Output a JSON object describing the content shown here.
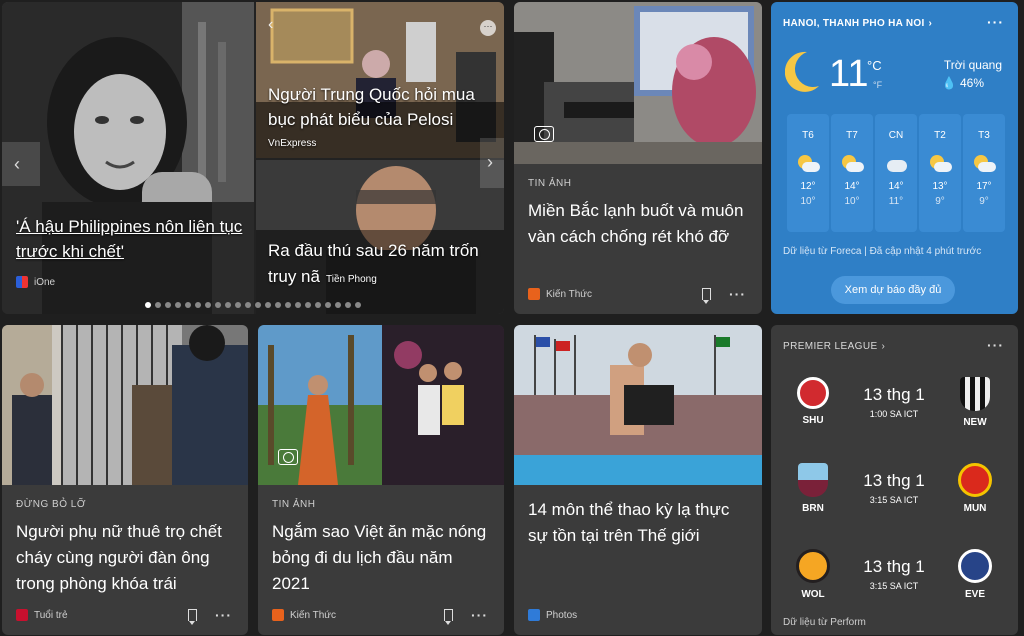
{
  "hero": {
    "left_title": "'Á hậu Philippines nôn liên tục trước khi chết'",
    "left_source": "iOne",
    "top_title": "Người Trung Quốc hỏi mua bục phát biểu của Pelosi",
    "top_source": "VnExpress",
    "bottom_title": "Ra đầu thú sau 26 năm trốn truy nã",
    "bottom_source": "Tiền Phong"
  },
  "card_cold": {
    "kicker": "TIN ẢNH",
    "title": "Miền Bắc lạnh buốt và muôn vàn cách chống rét khó đỡ",
    "source": "Kiến Thức",
    "more": "···"
  },
  "weather": {
    "location": "HANOI, THANH PHO HA NOI",
    "temp": "11",
    "unit_c": "°C",
    "unit_f": "°F",
    "condition": "Trời quang",
    "humidity": "💧 46%",
    "more": "···",
    "days": [
      {
        "d": "T6",
        "hi": "12°",
        "lo": "10°",
        "icon": "partly-sunny-icon"
      },
      {
        "d": "T7",
        "hi": "14°",
        "lo": "10°",
        "icon": "partly-sunny-icon"
      },
      {
        "d": "CN",
        "hi": "14°",
        "lo": "11°",
        "icon": "cloudy-icon"
      },
      {
        "d": "T2",
        "hi": "13°",
        "lo": "9°",
        "icon": "partly-sunny-icon"
      },
      {
        "d": "T3",
        "hi": "17°",
        "lo": "9°",
        "icon": "partly-sunny-icon"
      }
    ],
    "attribution": "Dữ liệu từ Foreca | Đã cập nhật 4 phút trước",
    "button": "Xem dự báo đầy đủ"
  },
  "card_rental": {
    "kicker": "ĐỪNG BỎ LỠ",
    "title": "Người phụ nữ thuê trọ chết cháy cùng người đàn ông trong phòng khóa trái",
    "source": "Tuổi trẻ",
    "more": "···"
  },
  "card_stars": {
    "kicker": "TIN ẢNH",
    "title": "Ngắm sao Việt ăn mặc nóng bỏng đi du lịch đầu năm 2021",
    "source": "Kiến Thức",
    "more": "···"
  },
  "card_sports": {
    "title": "14 môn thể thao kỳ lạ thực sự tồn tại trên Thế giới",
    "source": "Photos"
  },
  "league": {
    "name": "PREMIER LEAGUE",
    "more": "···",
    "matches": [
      {
        "home": "SHU",
        "away": "NEW",
        "date": "13 thg 1",
        "time": "1:00 SA ICT",
        "hc": "#d12a2f",
        "ac": "#222222"
      },
      {
        "home": "BRN",
        "away": "MUN",
        "date": "13 thg 1",
        "time": "3:15 SA ICT",
        "hc": "#7a2139",
        "ac": "#da291c"
      },
      {
        "home": "WOL",
        "away": "EVE",
        "date": "13 thg 1",
        "time": "3:15 SA ICT",
        "hc": "#f5a623",
        "ac": "#274488"
      }
    ],
    "attribution": "Dữ liệu từ Perform"
  }
}
